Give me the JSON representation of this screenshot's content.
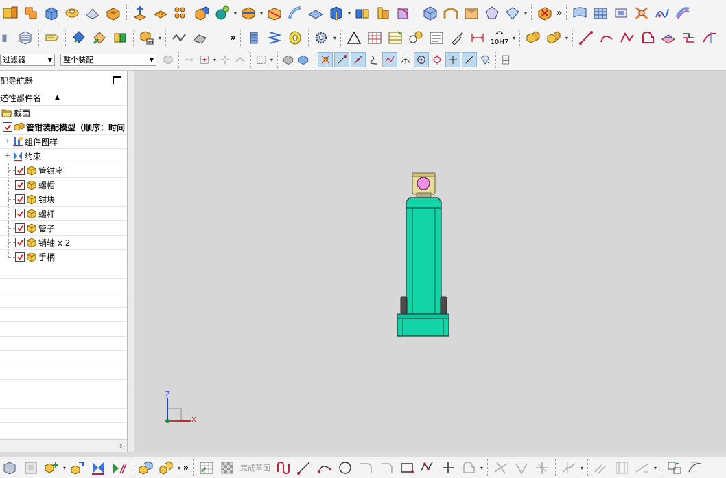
{
  "toolbar": {
    "more_glyph": "»",
    "quick_pick_label": "10H7",
    "filter_select": {
      "value": "过滤器"
    },
    "scope_select": {
      "value": "整个装配"
    },
    "sketch_finish_label": "完成草图"
  },
  "navigator": {
    "title": "配导航器",
    "column_header": "述性部件名",
    "scroll_right_glyph": "›",
    "items": [
      {
        "label": "截面",
        "bold": false
      },
      {
        "label": "管钳装配模型（顺序：时间",
        "bold": true
      },
      {
        "label": "组件图样"
      },
      {
        "label": "约束"
      },
      {
        "label": "管钳座"
      },
      {
        "label": "螺帽"
      },
      {
        "label": "钳块"
      },
      {
        "label": "螺杆"
      },
      {
        "label": "管子"
      },
      {
        "label": "销轴 x 2"
      },
      {
        "label": "手柄"
      }
    ]
  },
  "viewport": {
    "triad": {
      "z_label": "Z",
      "x_label": "X"
    },
    "colors": {
      "body": "#12d4a6",
      "cap": "#e9dc98",
      "knob": "#f08ee8",
      "background": "#d7d7d7"
    }
  }
}
